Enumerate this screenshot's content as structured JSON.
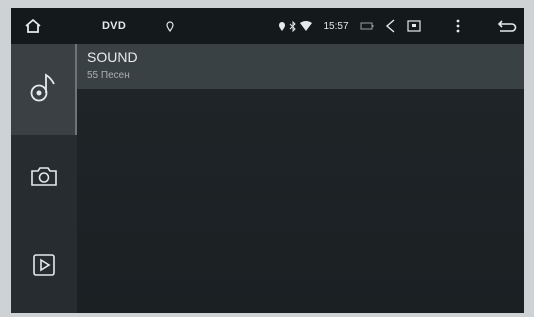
{
  "statusbar": {
    "title": "DVD",
    "time": "15:57",
    "icons": [
      "home-icon",
      "location-icon",
      "location-icon",
      "bluetooth-icon",
      "wifi-icon",
      "battery-icon",
      "volume-icon",
      "screen-icon",
      "more-icon",
      "back-icon"
    ]
  },
  "sidebar": {
    "items": [
      {
        "icon": "music-note-icon",
        "active": true
      },
      {
        "icon": "camera-icon",
        "active": false
      },
      {
        "icon": "video-play-icon",
        "active": false
      }
    ]
  },
  "list": {
    "items": [
      {
        "title": "SOUND",
        "subtitle": "55 Песен"
      }
    ]
  },
  "colors": {
    "statusbar": "#14191c",
    "sidebar": "#272c30",
    "active": "#3b4044",
    "content": "#1d2225",
    "row": "#3a4145"
  }
}
